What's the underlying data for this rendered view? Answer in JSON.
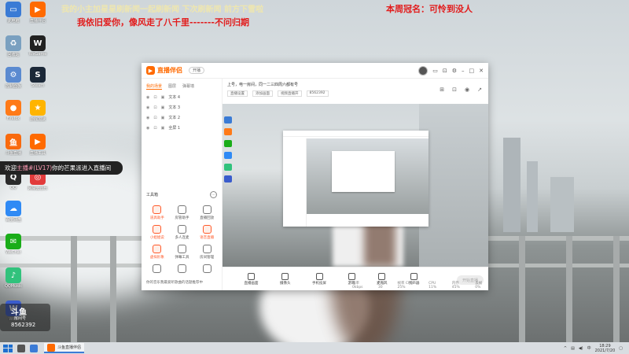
{
  "overlay": {
    "top_line_1": "我的小主加星星刷新闻一起刷新闻  下次刷新闻  前方下雪啦",
    "top_line_2": "我依旧爱你，像风走了八千里-------不问归期",
    "crown_text": "本周冠名：可怜到没人"
  },
  "desktop_icons": [
    {
      "label": "此电脑",
      "color": "#3a7bd5",
      "glyph": "▭"
    },
    {
      "label": "回收站",
      "color": "#7aa0c0",
      "glyph": "♻"
    },
    {
      "label": "控制面板",
      "color": "#5a8ad0",
      "glyph": "⚙"
    },
    {
      "label": "Firefox",
      "color": "#ff7a18",
      "glyph": "●"
    },
    {
      "label": "斗鱼直播",
      "color": "#f96a0e",
      "glyph": "鱼"
    },
    {
      "label": "QQ",
      "color": "#2a2a2a",
      "glyph": "Q"
    },
    {
      "label": "百度网盘",
      "color": "#2f8af5",
      "glyph": "☁"
    },
    {
      "label": "WeChat",
      "color": "#1aad19",
      "glyph": "✉"
    },
    {
      "label": "QQMusic",
      "color": "#31c27c",
      "glyph": "♪"
    },
    {
      "label": "WPS",
      "color": "#3a5ccc",
      "glyph": "W"
    }
  ],
  "desktop_icons_col2": [
    {
      "label": "直播伴侣",
      "color": "#ff6a00",
      "glyph": "▶"
    },
    {
      "label": "WeGame",
      "color": "#222",
      "glyph": "W"
    },
    {
      "label": "Steam",
      "color": "#1b2838",
      "glyph": "S"
    },
    {
      "label": "游戏加速",
      "color": "#ffb400",
      "glyph": "★"
    },
    {
      "label": "直播工具",
      "color": "#ff6a00",
      "glyph": "▶"
    },
    {
      "label": "网易云音乐",
      "color": "#e23b3b",
      "glyph": "◎"
    }
  ],
  "app": {
    "title": "直播伴侣",
    "pill": "开播",
    "left_tabs": [
      "我的场景",
      "图层",
      "弹幕墙"
    ],
    "layers": [
      "文本 4",
      "文本 3",
      "文本 2",
      "全屏 1"
    ],
    "tools_title": "工具箱",
    "tools": [
      {
        "label": "道具助手",
        "hot": true
      },
      {
        "label": "房管助手",
        "hot": false
      },
      {
        "label": "直播回放",
        "hot": false
      },
      {
        "label": "小姐姐说",
        "hot": true
      },
      {
        "label": "多人连麦",
        "hot": false
      },
      {
        "label": "语音直播",
        "hot": true
      },
      {
        "label": "虚拟形象",
        "hot": true
      },
      {
        "label": "弹幕工具",
        "hot": false
      },
      {
        "label": "房间管理",
        "hot": false
      },
      {
        "label": "",
        "hot": false
      },
      {
        "label": "",
        "hot": false
      },
      {
        "label": "",
        "hot": false
      }
    ],
    "left_footer": "你的音乐我最爱听歌曲的话题推荐中",
    "room_line": "上号，电一房间，同一二三四周六都有号",
    "head_chips": [
      "直播设置",
      "添加画面",
      "视频直播开",
      "8562392"
    ],
    "controls": [
      {
        "label": "直播画面"
      },
      {
        "label": "摄像头"
      },
      {
        "label": "手机投屏"
      },
      {
        "label": "游戏"
      },
      {
        "label": "麦克风"
      },
      {
        "label": "扬声器"
      }
    ],
    "start_button": "开始直播",
    "status": [
      "码率 0kbps",
      "FPS 30",
      "帧率 CPU 25%",
      "CPU 11%",
      "内存 45%",
      "丢帧 0%"
    ]
  },
  "toast": {
    "prefix": "欢迎",
    "user": "主播#(LV17)",
    "suffix": "你的芒果派进入直播间"
  },
  "watermark": {
    "line1": "斗鱼",
    "line2": "房间号",
    "line3": "8562392"
  },
  "taskbar": {
    "app_label": "斗鱼直播伴侣",
    "time": "18:29",
    "date": "2021/7/20",
    "lang": "中"
  }
}
